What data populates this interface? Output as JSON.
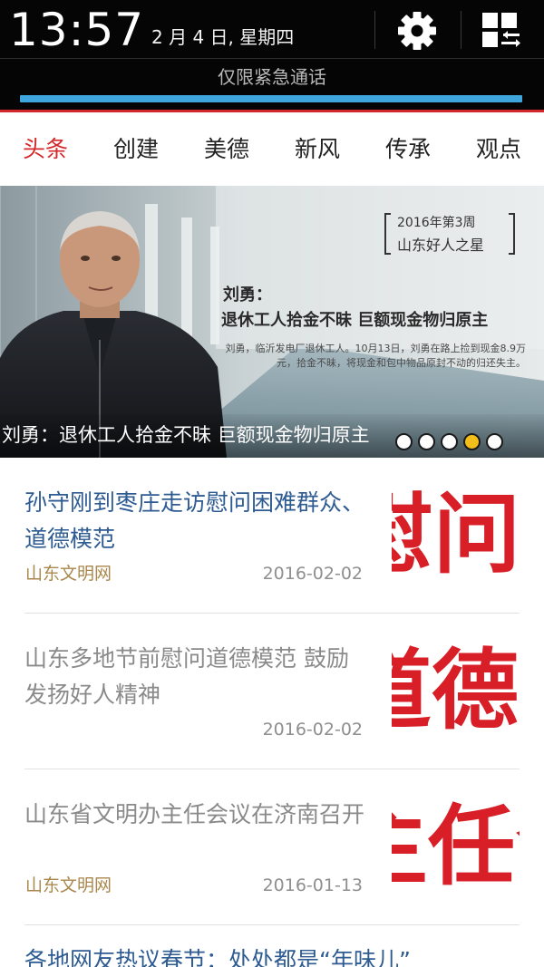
{
  "status_bar": {
    "time": "13:57",
    "date": "2 月 4 日, 星期四",
    "emergency_text": "仅限紧急通话",
    "settings_icon": "gear-icon",
    "quick_panel_icon": "grid-toggle-icon",
    "colors": {
      "progress": "#3fa6dd",
      "accent_line": "#d1272d"
    }
  },
  "tabs": [
    {
      "label": "头条",
      "active": true
    },
    {
      "label": "创建",
      "active": false
    },
    {
      "label": "美德",
      "active": false
    },
    {
      "label": "新风",
      "active": false
    },
    {
      "label": "传承",
      "active": false
    },
    {
      "label": "观点",
      "active": false
    }
  ],
  "banner": {
    "week_label": "2016年第3周",
    "award": "山东好人之星",
    "name": "刘勇：",
    "headline": "退休工人拾金不昧 巨额现金物归原主",
    "description": "刘勇，临沂发电厂退休工人。10月13日，刘勇在路上捡到现金8.9万元，拾金不昧，将现金和包中物品原封不动的归还失主。",
    "caption": "刘勇：退休工人拾金不昧 巨额现金物归原主",
    "dots_total": 5,
    "dots_active_index": 3
  },
  "news": [
    {
      "title": "孙守刚到枣庄走访慰问困难群众、道德模范",
      "source": "山东文明网",
      "date": "2016-02-02",
      "read": false,
      "thumb_text": "慰问困"
    },
    {
      "title": "山东多地节前慰问道德模范 鼓励发扬好人精神",
      "source": "",
      "date": "2016-02-02",
      "read": true,
      "thumb_text": "道德模范"
    },
    {
      "title": "山东省文明办主任会议在济南召开",
      "source": "山东文明网",
      "date": "2016-01-13",
      "read": true,
      "thumb_text": "主任会"
    }
  ],
  "partial_news_title": "各地网友热议春节：处处都是“年味儿”"
}
